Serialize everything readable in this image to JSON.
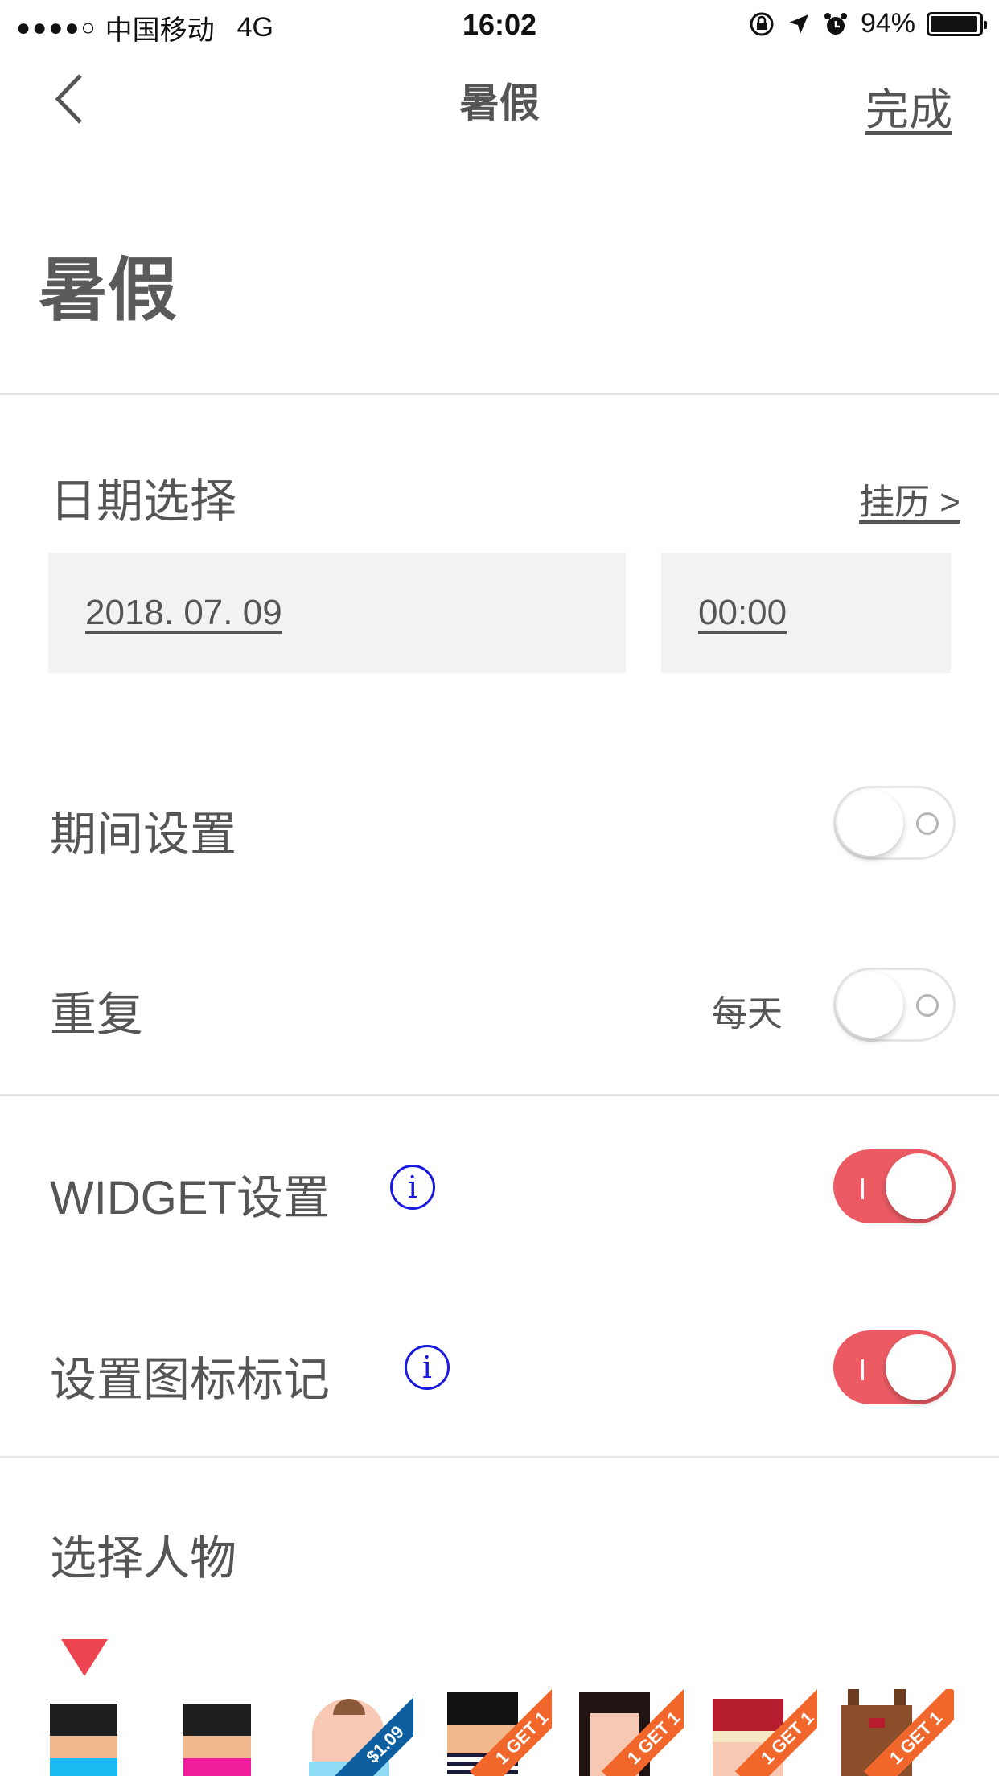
{
  "status_bar": {
    "signal": "●●●●○",
    "carrier": "中国移动",
    "network": "4G",
    "time": "16:02",
    "battery_percent": "94%",
    "battery_level": 0.94,
    "icons": [
      "orientation-lock-icon",
      "location-arrow-icon",
      "alarm-icon",
      "battery-icon"
    ]
  },
  "nav": {
    "back_icon": "chevron-left-icon",
    "title": "暑假",
    "done_label": "完成"
  },
  "event_title": "暑假",
  "date_section": {
    "label": "日期选择",
    "calendar_link": "挂历 >",
    "date_value": "2018. 07. 09",
    "time_value": "00:00"
  },
  "settings": {
    "period": {
      "label": "期间设置",
      "enabled": false
    },
    "repeat": {
      "label": "重复",
      "value": "每天",
      "enabled": false
    },
    "widget": {
      "label": "WIDGET设置",
      "info_icon": "info-icon",
      "info_glyph": "i",
      "enabled": true
    },
    "badge": {
      "label": "设置图标标记",
      "info_icon": "info-icon",
      "info_glyph": "i",
      "enabled": true
    }
  },
  "character_section": {
    "label": "选择人物",
    "selected_index": 0,
    "characters": [
      {
        "name": "character-1",
        "tag": ""
      },
      {
        "name": "character-2",
        "tag": ""
      },
      {
        "name": "character-baby",
        "tag": "$1.09"
      },
      {
        "name": "character-sailor",
        "tag": "1 GET 1"
      },
      {
        "name": "character-girl",
        "tag": "1 GET 1"
      },
      {
        "name": "character-santa",
        "tag": "1 GET 1"
      },
      {
        "name": "character-reindeer",
        "tag": "1 GET 1"
      }
    ]
  },
  "colors": {
    "accent": "#ec5b63",
    "info_blue": "#1a1ae0",
    "field_bg": "#f2f2f2",
    "divider": "#e2e2e2"
  }
}
